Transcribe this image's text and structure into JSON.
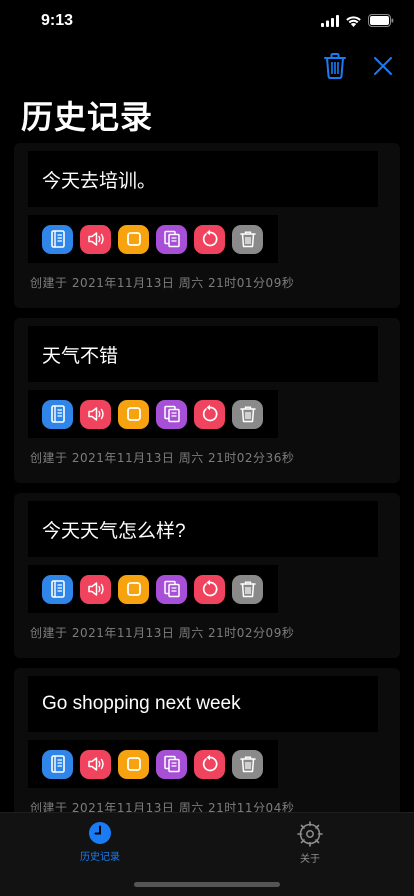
{
  "status": {
    "time": "9:13"
  },
  "header": {
    "title": "历史记录",
    "delete_icon": "trash-icon",
    "close_icon": "close-icon"
  },
  "colors": {
    "accent": "#1a7cf5",
    "book": "#2f86e8",
    "speaker": "#f0435e",
    "square": "#f7a20f",
    "copy": "#a74fd6",
    "undo": "#f0435e",
    "trash": "#8a8a8a"
  },
  "records": [
    {
      "text": "今天去培训。",
      "date": "创建于 2021年11月13日  周六   21时01分09秒"
    },
    {
      "text": "天气不错",
      "date": "创建于 2021年11月13日  周六   21时02分36秒"
    },
    {
      "text": "今天天气怎么样?",
      "date": "创建于 2021年11月13日  周六   21时02分09秒"
    },
    {
      "text": "Go shopping next week",
      "date": "创建于 2021年11月13日  周六   21时11分04秒"
    }
  ],
  "actions": [
    "book-icon",
    "speaker-icon",
    "square-icon",
    "copy-icon",
    "undo-icon",
    "trash-icon"
  ],
  "tabs": [
    {
      "label": "历史记录",
      "icon": "clock-icon",
      "active": true
    },
    {
      "label": "关于",
      "icon": "gear-icon",
      "active": false
    }
  ]
}
